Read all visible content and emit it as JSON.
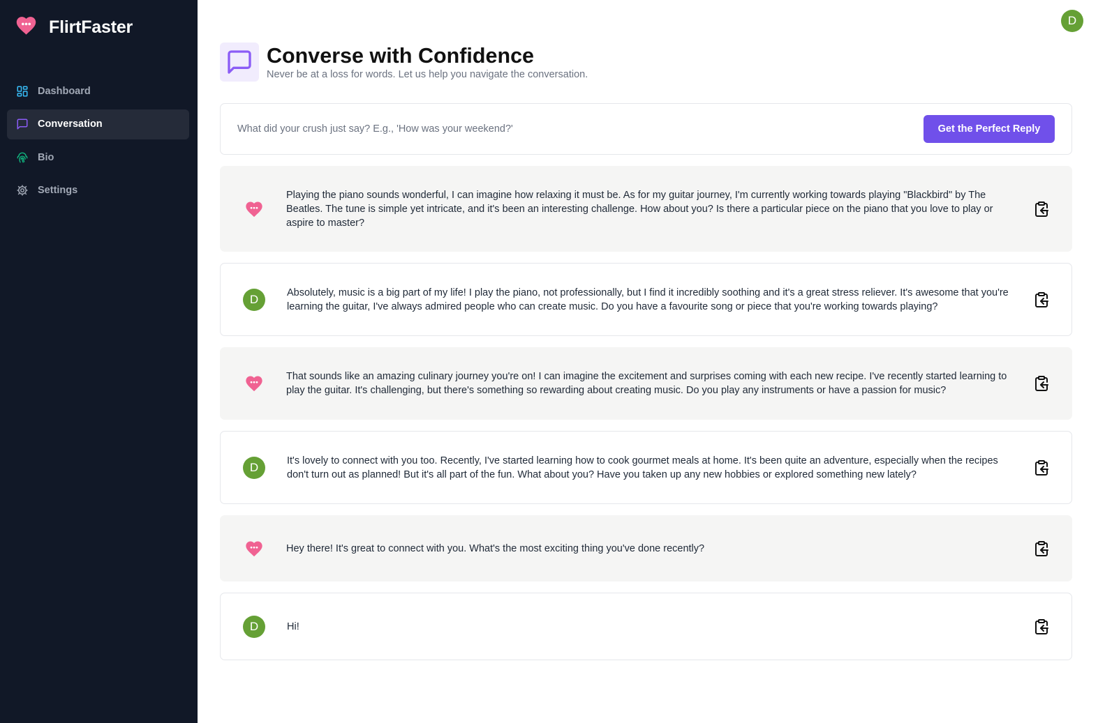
{
  "app": {
    "name": "FlirtFaster",
    "user_initial": "D"
  },
  "sidebar": {
    "items": [
      {
        "label": "Dashboard",
        "icon": "grid-icon",
        "color": "#38bdf8"
      },
      {
        "label": "Conversation",
        "icon": "message-square-icon",
        "color": "#8b5cf6",
        "active": true
      },
      {
        "label": "Bio",
        "icon": "fingerprint-icon",
        "color": "#10b981"
      },
      {
        "label": "Settings",
        "icon": "gear-icon",
        "color": "#a1a8b5"
      }
    ]
  },
  "header": {
    "title": "Converse with Confidence",
    "subtitle": "Never be at a loss for words. Let us help you navigate the conversation.",
    "icon": "message-square-icon"
  },
  "prompt": {
    "placeholder": "What did your crush just say? E.g., 'How was your weekend?'",
    "value": "",
    "button_label": "Get the Perfect Reply"
  },
  "messages": [
    {
      "role": "bot",
      "text": "Playing the piano sounds wonderful, I can imagine how relaxing it must be. As for my guitar journey, I'm currently working towards playing \"Blackbird\" by The Beatles. The tune is simple yet intricate, and it's been an interesting challenge. How about you? Is there a particular piece on the piano that you love to play or aspire to master?"
    },
    {
      "role": "user",
      "text": "Absolutely, music is a big part of my life! I play the piano, not professionally, but I find it incredibly soothing and it's a great stress reliever. It's awesome that you're learning the guitar, I've always admired people who can create music. Do you have a favourite song or piece that you're working towards playing?"
    },
    {
      "role": "bot",
      "text": "That sounds like an amazing culinary journey you're on! I can imagine the excitement and surprises coming with each new recipe. I've recently started learning to play the guitar. It's challenging, but there's something so rewarding about creating music. Do you play any instruments or have a passion for music?"
    },
    {
      "role": "user",
      "text": "It's lovely to connect with you too. Recently, I've started learning how to cook gourmet meals at home. It's been quite an adventure, especially when the recipes don't turn out as planned! But it's all part of the fun. What about you? Have you taken up any new hobbies or explored something new lately?"
    },
    {
      "role": "bot",
      "text": "Hey there! It's great to connect with you. What's the most exciting thing you've done recently?"
    },
    {
      "role": "user",
      "text": "Hi!"
    }
  ],
  "colors": {
    "sidebar_bg": "#111827",
    "accent": "#7050ea",
    "heart": "#f06292",
    "avatar": "#65a035"
  }
}
